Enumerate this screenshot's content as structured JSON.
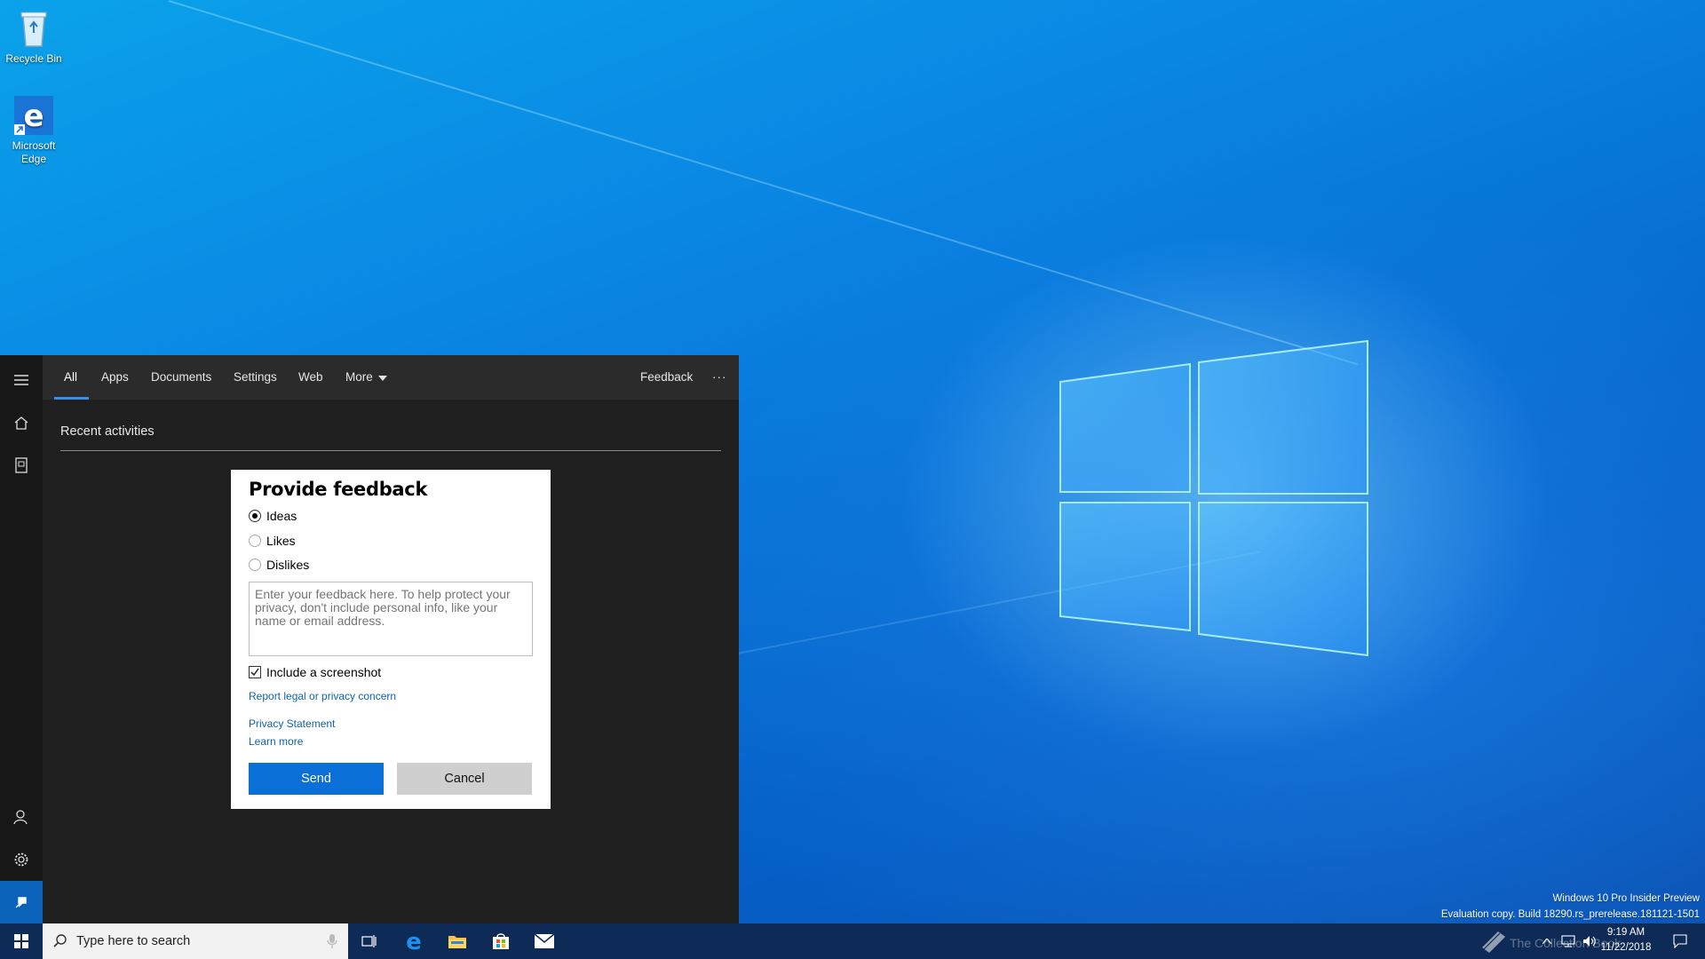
{
  "desktop": {
    "icons": [
      {
        "label": "Recycle Bin",
        "icon": "recycle-bin-icon"
      },
      {
        "label": "Microsoft Edge",
        "icon": "edge-icon"
      }
    ]
  },
  "search_panel": {
    "tabs": [
      {
        "label": "All",
        "active": true
      },
      {
        "label": "Apps"
      },
      {
        "label": "Documents"
      },
      {
        "label": "Settings"
      },
      {
        "label": "Web"
      },
      {
        "label": "More"
      }
    ],
    "feedback_label": "Feedback",
    "more_options": "···",
    "section_title": "Recent activities",
    "rail_icons": [
      "hamburger-menu-icon",
      "home-icon",
      "notebook-icon",
      "account-icon",
      "gear-icon",
      "feedback-icon"
    ]
  },
  "dialog": {
    "title": "Provide feedback",
    "options": [
      {
        "label": "Ideas",
        "selected": true
      },
      {
        "label": "Likes",
        "selected": false
      },
      {
        "label": "Dislikes",
        "selected": false
      }
    ],
    "textarea_placeholder": "Enter your feedback here. To help protect your privacy, don't include personal info, like your name or email address.",
    "include_screenshot_label": "Include a screenshot",
    "include_screenshot_checked": true,
    "links": {
      "report": "Report legal or privacy concern",
      "privacy": "Privacy Statement",
      "learn_more": "Learn more"
    },
    "send_label": "Send",
    "cancel_label": "Cancel"
  },
  "taskbar": {
    "search_placeholder": "Type here to search",
    "time": "9:19 AM",
    "date": "11/22/2018",
    "pinned": [
      "task-view-icon",
      "edge-icon",
      "file-explorer-icon",
      "store-icon",
      "mail-icon"
    ]
  },
  "watermark": {
    "line1": "Windows 10 Pro Insider Preview",
    "line2": "Evaluation copy. Build 18290.rs_prerelease.181121-1501",
    "brand": "The Collection Book"
  },
  "colors": {
    "accent": "#0a6fd6",
    "panel_bg": "#1f1f1f",
    "taskbar_bg": "#0e2a56"
  }
}
